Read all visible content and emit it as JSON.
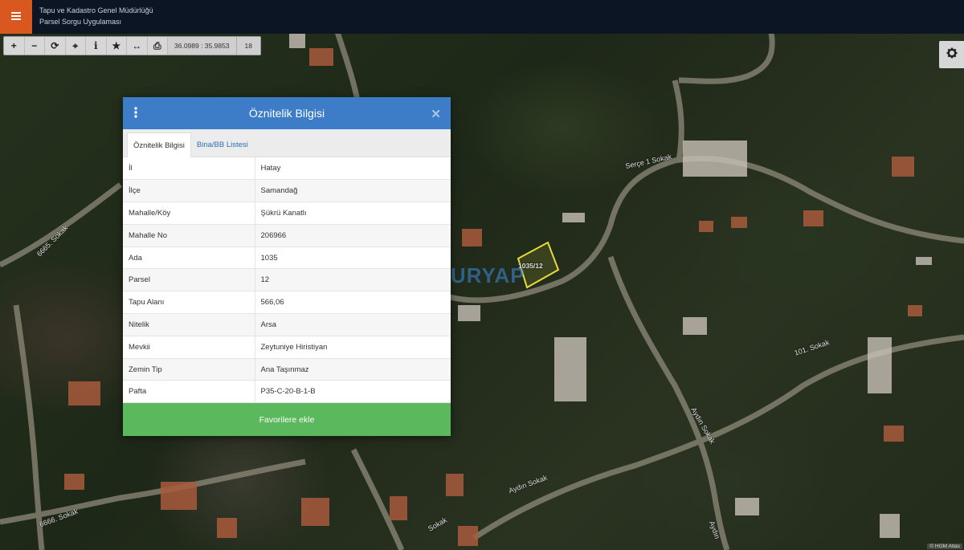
{
  "header": {
    "menu_icon": "hamburger-icon",
    "title_line1": "Tapu ve Kadastro Genel Müdürlüğü",
    "title_line2": "Parsel Sorgu Uygulaması",
    "menu_color": "#d9581f",
    "bar_color": "#0b1524"
  },
  "toolbar": {
    "buttons": [
      {
        "name": "zoom-in",
        "icon": "plus-icon",
        "glyph": "+"
      },
      {
        "name": "zoom-out",
        "icon": "minus-icon",
        "glyph": "−"
      },
      {
        "name": "refresh",
        "icon": "refresh-icon",
        "glyph": "⟳"
      },
      {
        "name": "locate",
        "icon": "crosshair-icon",
        "glyph": "⌖"
      },
      {
        "name": "info",
        "icon": "info-icon",
        "glyph": "i"
      },
      {
        "name": "favorite",
        "icon": "star-icon",
        "glyph": "★"
      },
      {
        "name": "measure",
        "icon": "measure-icon",
        "glyph": "↔"
      },
      {
        "name": "print",
        "icon": "print-icon",
        "glyph": "⎙"
      }
    ],
    "coordinates": "36.0989 : 35.9853",
    "zoom_level": "18"
  },
  "settings": {
    "icon": "gear-icon"
  },
  "watermark": {
    "text": "TURYAP"
  },
  "parcel_label": "1035/12",
  "streets": {
    "s1": "Serçe 1 Sokak",
    "s2": "6665. Sokak",
    "s3": "101. Sokak",
    "s4": "Aydın Sokak",
    "s5": "Aydın Sokak",
    "s6": "6666. Sokak",
    "s7": "Aydın",
    "s8": "Sokak"
  },
  "dialog": {
    "title": "Öznitelik Bilgisi",
    "close_glyph": "✕",
    "header_color": "#3d7dc7",
    "tabs": {
      "active": "Öznitelik Bilgisi",
      "second": "Bina/BB Listesi"
    },
    "rows": [
      {
        "key": "İl",
        "value": "Hatay"
      },
      {
        "key": "İlçe",
        "value": "Samandağ"
      },
      {
        "key": "Mahalle/Köy",
        "value": "Şükrü Kanatlı"
      },
      {
        "key": "Mahalle No",
        "value": "206966"
      },
      {
        "key": "Ada",
        "value": "1035"
      },
      {
        "key": "Parsel",
        "value": "12"
      },
      {
        "key": "Tapu Alanı",
        "value": "566,06"
      },
      {
        "key": "Nitelik",
        "value": "Arsa"
      },
      {
        "key": "Mevkii",
        "value": "Zeytuniye Hiristiyan"
      },
      {
        "key": "Zemin Tip",
        "value": "Ana Taşınmaz"
      },
      {
        "key": "Pafta",
        "value": "P35-C-20-B-1-B"
      }
    ],
    "favorite_button": "Favorilere ekle",
    "favorite_color": "#5cb85c"
  },
  "attribution": "© HGM Atlas"
}
